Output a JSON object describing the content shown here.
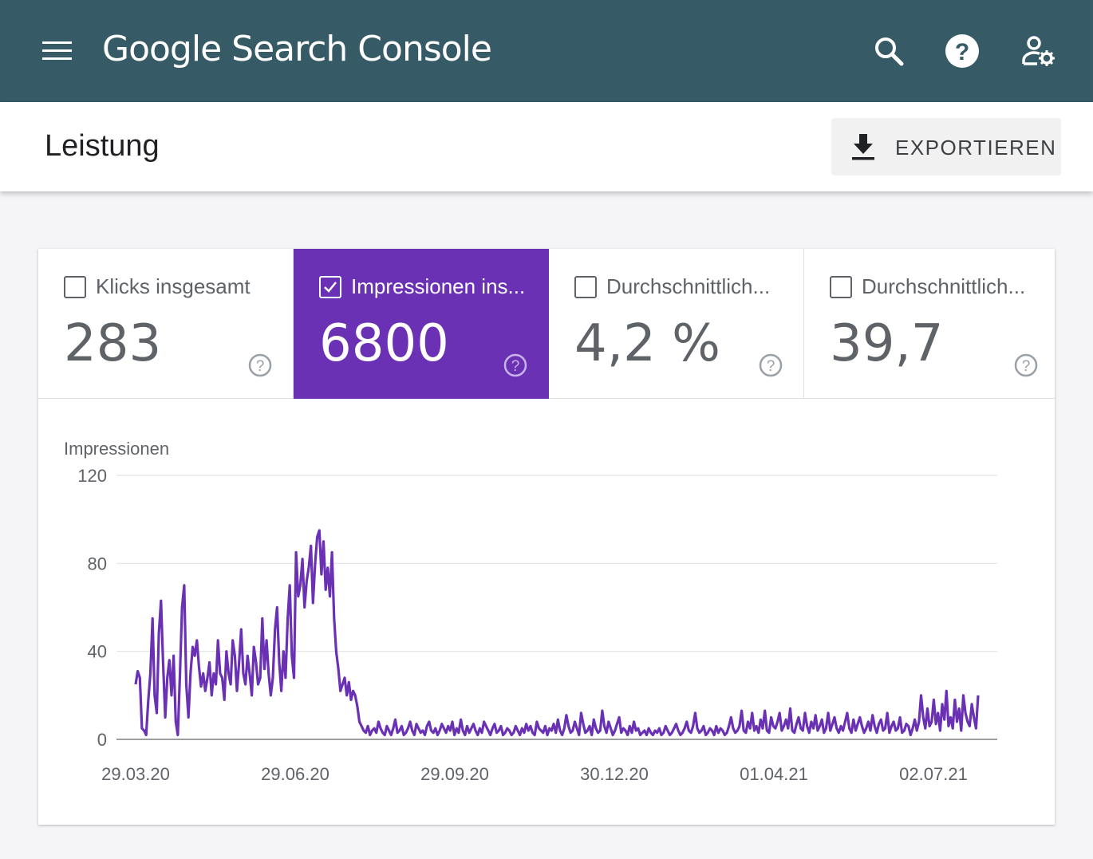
{
  "app": {
    "title": "Google Search Console",
    "icons": [
      "menu-icon",
      "search-icon",
      "help-icon",
      "account-settings-icon"
    ],
    "colors": {
      "appbar": "#365a66",
      "accent": "#6a31b4",
      "line": "#6a31b4"
    }
  },
  "header": {
    "title": "Leistung",
    "export_label": "EXPORTIEREN"
  },
  "metrics": [
    {
      "label": "Klicks insgesamt",
      "value": "283",
      "checked": false
    },
    {
      "label": "Impressionen ins...",
      "value": "6800",
      "checked": true
    },
    {
      "label": "Durchschnittlich...",
      "value": "4,2 %",
      "checked": false
    },
    {
      "label": "Durchschnittlich...",
      "value": "39,7",
      "checked": false
    }
  ],
  "chart_data": {
    "type": "line",
    "ylabel": "Impressionen",
    "ylim": [
      0,
      120
    ],
    "yticks": [
      "0",
      "40",
      "80",
      "120"
    ],
    "xticks": [
      "29.03.20",
      "29.06.20",
      "29.09.20",
      "30.12.20",
      "01.04.21",
      "02.07.21"
    ],
    "x_start": "29.03.20",
    "x_end": "14.07.21",
    "grid": true,
    "series": [
      {
        "values": [
          25,
          31,
          28,
          5,
          4,
          2,
          18,
          30,
          55,
          20,
          12,
          48,
          63,
          35,
          10,
          28,
          36,
          20,
          38,
          8,
          2,
          30,
          60,
          70,
          25,
          10,
          30,
          42,
          38,
          45,
          33,
          24,
          30,
          22,
          28,
          35,
          20,
          30,
          25,
          45,
          30,
          28,
          18,
          40,
          30,
          25,
          45,
          38,
          22,
          35,
          50,
          30,
          25,
          38,
          30,
          20,
          42,
          35,
          25,
          28,
          55,
          32,
          45,
          30,
          20,
          28,
          50,
          60,
          35,
          22,
          40,
          28,
          55,
          70,
          38,
          28,
          85,
          65,
          70,
          82,
          60,
          72,
          78,
          88,
          62,
          80,
          92,
          95,
          75,
          90,
          68,
          78,
          65,
          85,
          55,
          40,
          32,
          22,
          25,
          28,
          20,
          26,
          18,
          22,
          20,
          15,
          8,
          6,
          4,
          3,
          6,
          2,
          4,
          5,
          3,
          8,
          5,
          3,
          2,
          6,
          4,
          2,
          5,
          9,
          3,
          4,
          6,
          2,
          3,
          5,
          8,
          4,
          2,
          7,
          5,
          3,
          4,
          2,
          6,
          8,
          4,
          3,
          5,
          2,
          4,
          7,
          5,
          3,
          6,
          4,
          8,
          2,
          5,
          3,
          9,
          4,
          2,
          6,
          3,
          5,
          7,
          4,
          2,
          5,
          3,
          8,
          6,
          4,
          2,
          5,
          7,
          3,
          4,
          6,
          2,
          3,
          5,
          4,
          2,
          3,
          6,
          4,
          2,
          5,
          3,
          7,
          4,
          6,
          3,
          2,
          8,
          5,
          4,
          3,
          6,
          2,
          5,
          4,
          7,
          3,
          9,
          4,
          2,
          5,
          11,
          6,
          3,
          4,
          8,
          5,
          2,
          12,
          7,
          3,
          4,
          6,
          2,
          9,
          5,
          3,
          4,
          13,
          6,
          3,
          8,
          5,
          2,
          4,
          7,
          10,
          3,
          5,
          4,
          2,
          6,
          3,
          8,
          4,
          5,
          2,
          3,
          4,
          2,
          5,
          3,
          2,
          4,
          3,
          5,
          2,
          3,
          6,
          4,
          2,
          3,
          5,
          7,
          4,
          2,
          3,
          5,
          8,
          4,
          3,
          6,
          12,
          5,
          3,
          4,
          6,
          2,
          3,
          5,
          4,
          2,
          6,
          3,
          5,
          4,
          2,
          3,
          6,
          10,
          5,
          3,
          4,
          6,
          13,
          4,
          3,
          8,
          5,
          12,
          4,
          6,
          3,
          9,
          5,
          13,
          4,
          3,
          10,
          6,
          5,
          8,
          12,
          4,
          6,
          9,
          5,
          14,
          4,
          3,
          7,
          10,
          5,
          4,
          12,
          6,
          3,
          8,
          5,
          11,
          4,
          6,
          9,
          3,
          5,
          12,
          4,
          7,
          10,
          5,
          3,
          6,
          4,
          8,
          12,
          5,
          3,
          9,
          4,
          7,
          10,
          6,
          3,
          5,
          8,
          4,
          11,
          6,
          3,
          7,
          9,
          4,
          5,
          12,
          3,
          6,
          8,
          4,
          5,
          10,
          3,
          4,
          7,
          6,
          2,
          5,
          9,
          4,
          8,
          20,
          10,
          5,
          14,
          6,
          8,
          18,
          7,
          12,
          4,
          16,
          9,
          22,
          6,
          10,
          5,
          18,
          8,
          14,
          4,
          20,
          12,
          8,
          6,
          16,
          10,
          5,
          20
        ]
      }
    ]
  }
}
